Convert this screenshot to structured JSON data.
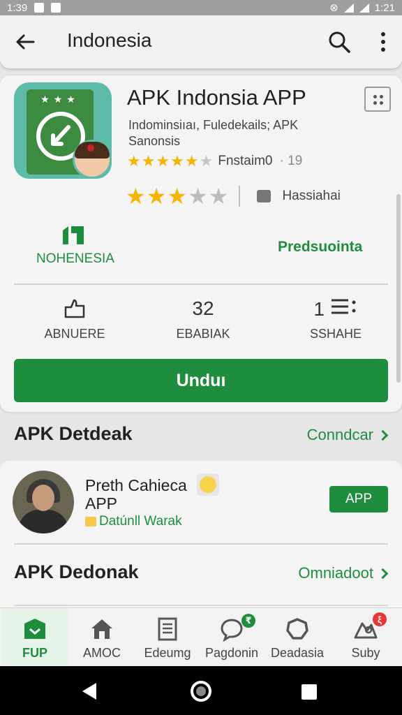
{
  "status_bar": {
    "time_left": "1:39",
    "time_right": "1:21"
  },
  "app_bar": {
    "title": "Indonesia"
  },
  "app": {
    "title": "APK Indonsia APP",
    "subtitle": "Indominsiıaı, Fuledekails; APK Sanonsis",
    "rating_label": "Fnstaim0",
    "rating_count": "· 19",
    "category_label": "Hassiahai",
    "rating_stars": 3,
    "small_rating_stars": 5
  },
  "brand": {
    "label": "NOHENESIA"
  },
  "pred_link": "Predsuointa",
  "stats": [
    {
      "value": "",
      "label": "ABNUERE",
      "icon": "share-icon"
    },
    {
      "value": "32",
      "label": "EBABIAK"
    },
    {
      "value": "1",
      "label": "SSHAHE",
      "icon": "list-icon"
    }
  ],
  "download_button": "Unduı",
  "section1": {
    "title": "APK Detdeak",
    "link": "Conndcar"
  },
  "developer": {
    "name": "Preth Cahieca APP",
    "meta": "Datúnll Warak",
    "button": "APP"
  },
  "section2": {
    "title": "APK Dedonak",
    "link": "Omniadoot"
  },
  "bottom_nav": [
    {
      "label": "FUP",
      "icon": "store-icon",
      "active": true
    },
    {
      "label": "AMOC",
      "icon": "home-icon"
    },
    {
      "label": "Edeumg",
      "icon": "document-icon"
    },
    {
      "label": "Pagdonin",
      "icon": "chat-icon",
      "badge": "₹"
    },
    {
      "label": "Deadasia",
      "icon": "shield-icon"
    },
    {
      "label": "Suby",
      "icon": "profile-icon",
      "badge": "ξ"
    }
  ],
  "colors": {
    "accent": "#1e8e3e",
    "star": "#f4b400"
  }
}
